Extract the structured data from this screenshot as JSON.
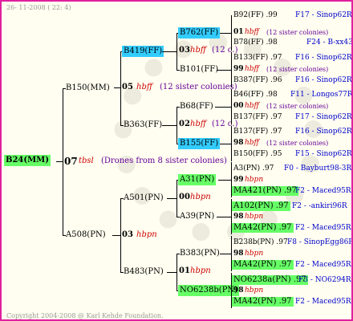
{
  "header": {
    "date": "26- 11-2008 ( 22: 4)"
  },
  "footer": {
    "copyright": "Copyright 2004-2008 @ Karl Kehde Foundation."
  },
  "root": {
    "id": "B24(MM)",
    "gen": "07",
    "code": "tbsl",
    "note": "(Drones from 8 sister colonies)"
  },
  "parents": [
    {
      "id": "B150(MM)",
      "gen": "05",
      "code": "hbff",
      "note": "(12 sister colonies)"
    },
    {
      "id": "A508(PN)",
      "gen": "03",
      "code": "hbpn"
    }
  ],
  "grand": [
    {
      "id": "B419(FF)",
      "gen": "03",
      "code": "hbff",
      "note": "(12 c.)"
    },
    {
      "id": "B363(FF)",
      "gen": "02",
      "code": "hbff",
      "note": "(12 c.)"
    },
    {
      "id": "A501(PN)",
      "gen": "00",
      "code": "hbpn"
    },
    {
      "id": "B483(PN)",
      "gen": "01",
      "code": "hbpn"
    }
  ],
  "great": [
    {
      "id": "B762(FF)"
    },
    {
      "id": "B101(FF)"
    },
    {
      "id": "B68(FF)"
    },
    {
      "id": "B155(FF)"
    },
    {
      "id": "A31(PN)"
    },
    {
      "id": "A39(PN)"
    },
    {
      "id": "B383(PN)"
    },
    {
      "id": "NO6238b(PN)"
    }
  ],
  "leaves": [
    {
      "a": "B92(FF) .99",
      "ar": "F17 - Sinop62R",
      "g": "01",
      "c": "hbff",
      "n": "(12 sister colonies)",
      "b": "B78(FF) .98",
      "br": "F24 - B-xx43"
    },
    {
      "a": "B133(FF) .97",
      "ar": "F16 - Sinop62R",
      "g": "99",
      "c": "hbff",
      "n": "(12 sister colonies)",
      "b": "B387(FF) .96",
      "br": "F16 - Sinop62R"
    },
    {
      "a": "B46(FF) .98",
      "ar": "F11 - Longos77R",
      "g": "00",
      "c": "hbff",
      "n": "(12 sister colonies)",
      "b": "B137(FF) .97",
      "br": "F17 - Sinop62R"
    },
    {
      "a": "B137(FF) .97",
      "ar": "F16 - Sinop62R",
      "g": "98",
      "c": "hbff",
      "n": "(12 sister colonies)",
      "b": "B150(FF) .95",
      "br": "F15 - Sinop62R"
    },
    {
      "a": "A3(PN) .97",
      "ar": "F0 - Bayburt98-3R",
      "g": "99",
      "c": "hbpn",
      "n": "",
      "b": "MA421(PN) .97",
      "br": "F2 - Maced95R"
    },
    {
      "a": "A102(PN) .97",
      "ar": "F2 - -ankiri96R",
      "g": "98",
      "c": "hbpn",
      "n": "",
      "b": "MA42(PN) .97",
      "br": "F2 - Maced95R"
    },
    {
      "a": "B238b(PN) .97",
      "ar": "F8 - SinopEgg86R",
      "g": "98",
      "c": "hbpn",
      "n": "",
      "b": "MA42(PN) .97",
      "br": "F2 - Maced95R"
    },
    {
      "a": "NO6238a(PN) .97",
      "ar": "F3 - NO6294R",
      "g": "98",
      "c": "hbpn",
      "n": "",
      "b": "MA42(PN) .97",
      "br": "F2 - Maced95R"
    }
  ],
  "colors": {
    "border": "#e020a0",
    "green": "#66ff66",
    "cyan": "#33ccff",
    "code": "#cc0000",
    "ref": "#0000cc"
  }
}
